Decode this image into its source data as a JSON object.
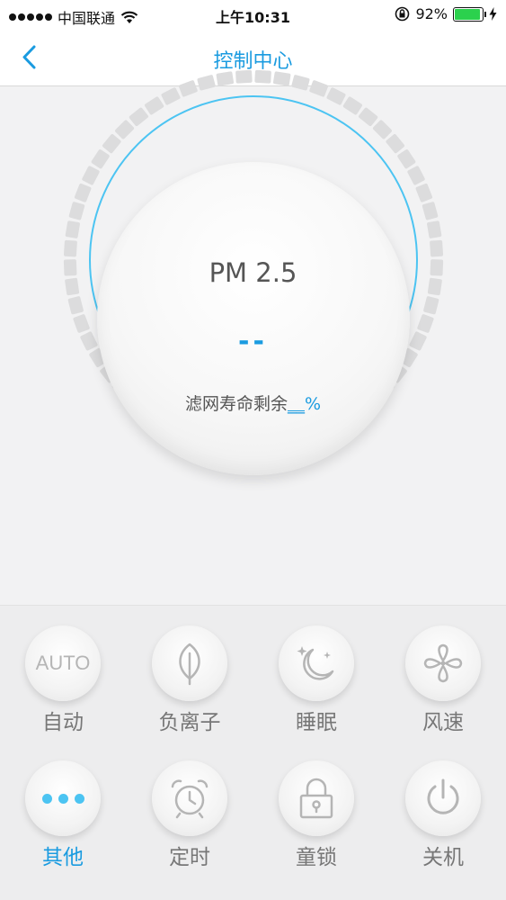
{
  "status_bar": {
    "carrier": "中国联通",
    "time": "上午10:31",
    "battery_percent": "92%",
    "battery_level": 0.92,
    "icons": [
      "signal-dots-icon",
      "wifi-icon",
      "rotation-lock-icon",
      "battery-icon",
      "charging-icon"
    ]
  },
  "nav": {
    "title": "控制中心",
    "back_icon": "chevron-left-icon"
  },
  "dial": {
    "label": "PM 2.5",
    "value": "--",
    "filter_prefix": "滤网寿命剩余",
    "filter_value": "__",
    "filter_unit": "%"
  },
  "controls": {
    "auto": {
      "label": "自动",
      "icon_text": "AUTO"
    },
    "anion": {
      "label": "负离子",
      "icon": "leaf-icon"
    },
    "sleep": {
      "label": "睡眠",
      "icon": "moon-stars-icon"
    },
    "wind": {
      "label": "风速",
      "icon": "fan-icon"
    },
    "more": {
      "label": "其他",
      "icon": "more-dots-icon",
      "active": true
    },
    "timer": {
      "label": "定时",
      "icon": "alarm-clock-icon"
    },
    "lock": {
      "label": "童锁",
      "icon": "lock-icon"
    },
    "power": {
      "label": "关机",
      "icon": "power-icon"
    }
  },
  "colors": {
    "accent": "#1a9be0",
    "accent_light": "#4cc4f2",
    "battery_green": "#2bd14d",
    "icon_gray": "#b5b5b5"
  }
}
